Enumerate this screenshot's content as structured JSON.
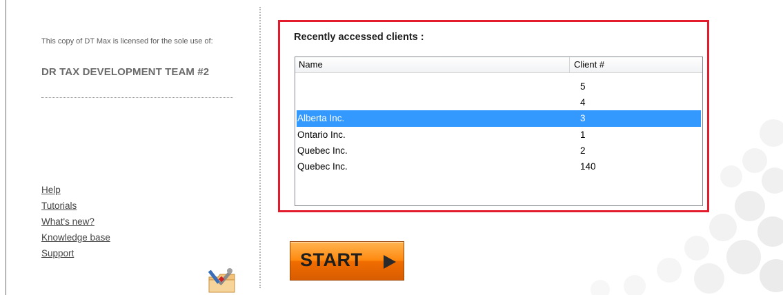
{
  "license": {
    "text": "This copy of DT Max is licensed for the sole use of:",
    "licensee": "DR TAX DEVELOPMENT TEAM #2"
  },
  "links": [
    {
      "label": "Help"
    },
    {
      "label": "Tutorials"
    },
    {
      "label": "What's new?"
    },
    {
      "label": "Knowledge base"
    },
    {
      "label": "Support"
    }
  ],
  "recent": {
    "title": "Recently accessed clients :",
    "columns": {
      "name": "Name",
      "client": "Client #"
    },
    "rows": [
      {
        "name": "",
        "client": "5",
        "selected": false
      },
      {
        "name": "",
        "client": "4",
        "selected": false
      },
      {
        "name": "Alberta Inc.",
        "client": "3",
        "selected": true
      },
      {
        "name": "Ontario Inc.",
        "client": "1",
        "selected": false
      },
      {
        "name": "Quebec Inc.",
        "client": "2",
        "selected": false
      },
      {
        "name": "Quebec Inc.",
        "client": "140",
        "selected": false
      }
    ]
  },
  "start_button": {
    "label": "START"
  },
  "icons": {
    "tools": "tools-folder-icon",
    "start_arrow": "play-arrow-icon"
  },
  "colors": {
    "highlight_border": "#e21c2c",
    "selection": "#3399ff",
    "start_button": "#ff8a10"
  }
}
